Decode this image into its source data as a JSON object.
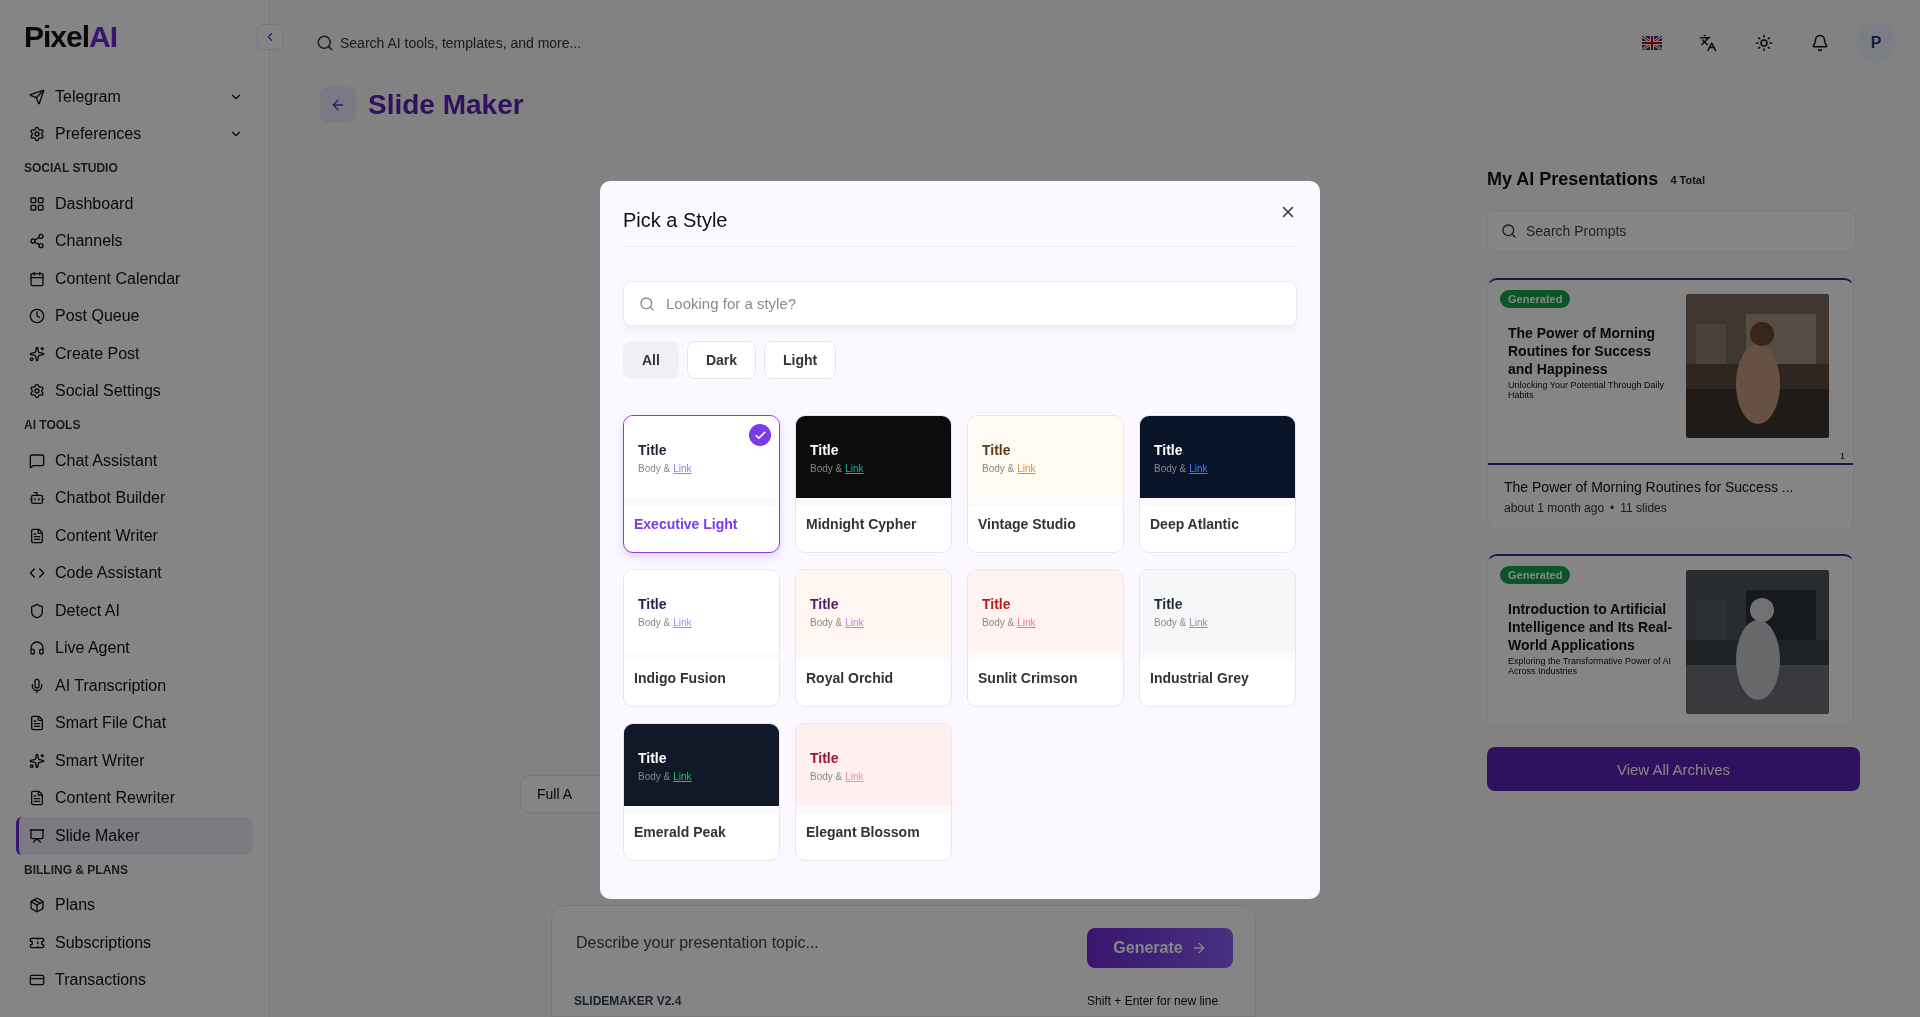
{
  "sidebar": {
    "logo": {
      "text": "Pixel",
      "accent": "AI"
    },
    "top_items": [
      {
        "label": "Telegram",
        "expanded": false
      },
      {
        "label": "Preferences",
        "expanded": false
      }
    ],
    "sections": [
      {
        "heading": "SOCIAL STUDIO",
        "items": [
          {
            "label": "Dashboard",
            "selected": false
          },
          {
            "label": "Channels",
            "selected": false
          },
          {
            "label": "Content Calendar",
            "selected": false
          },
          {
            "label": "Post Queue",
            "selected": false
          },
          {
            "label": "Create Post",
            "selected": false
          },
          {
            "label": "Social Settings",
            "selected": false
          }
        ]
      },
      {
        "heading": "AI TOOLS",
        "items": [
          {
            "label": "Chat Assistant",
            "selected": false
          },
          {
            "label": "Chatbot Builder",
            "selected": false
          },
          {
            "label": "Content Writer",
            "selected": false
          },
          {
            "label": "Code Assistant",
            "selected": false
          },
          {
            "label": "Detect AI",
            "selected": false
          },
          {
            "label": "Live Agent",
            "selected": false
          },
          {
            "label": "AI Transcription",
            "selected": false
          },
          {
            "label": "Smart File Chat",
            "selected": false
          },
          {
            "label": "Smart Writer",
            "selected": false
          },
          {
            "label": "Content Rewriter",
            "selected": false
          },
          {
            "label": "Slide Maker",
            "selected": true
          }
        ]
      },
      {
        "heading": "BILLING & PLANS",
        "items": [
          {
            "label": "Plans",
            "selected": false
          },
          {
            "label": "Subscriptions",
            "selected": false
          },
          {
            "label": "Transactions",
            "selected": false
          }
        ]
      }
    ]
  },
  "header": {
    "search": {
      "placeholder": "Search AI tools, templates, and more..."
    },
    "avatar": "P"
  },
  "page": {
    "title": "Slide Maker",
    "chip": "Full A",
    "prompt": {
      "placeholder": "Describe your presentation topic...",
      "button": "Generate",
      "version": "SLIDEMAKER V2.4",
      "hint": "Shift + Enter for new line"
    }
  },
  "presentations": {
    "title": "My AI Presentations",
    "count": "4 Total",
    "search": {
      "placeholder": "Search Prompts"
    },
    "cards": [
      {
        "badge": "Generated",
        "slide_title": "The Power of Morning Routines for Success and Happiness",
        "slide_subtitle": "Unlocking Your Potential Through Daily Habits",
        "slide_number": "1",
        "title": "The Power of Morning Routines for Success ...",
        "age": "about 1 month ago",
        "separator": "•",
        "slides": "11 slides"
      },
      {
        "badge": "Generated",
        "slide_title": "Introduction to Artificial Intelligence and Its Real-World Applications",
        "slide_subtitle": "Exploring the Transformative Power of AI Across Industries"
      }
    ],
    "button": "View All Archives"
  },
  "modal": {
    "title": "Pick a Style",
    "search": {
      "placeholder": "Looking for a style?"
    },
    "filters": [
      {
        "label": "All",
        "selected": true
      },
      {
        "label": "Dark",
        "selected": false
      },
      {
        "label": "Light",
        "selected": false
      }
    ],
    "styles": [
      {
        "name": "Executive Light",
        "selected": true,
        "color": "#ffffff",
        "title": "Title",
        "body": "Body &",
        "link": "Link"
      },
      {
        "name": "Midnight Cypher",
        "selected": false,
        "color": "#0c0c0c",
        "title": "Title",
        "body": "Body &",
        "link": "Link"
      },
      {
        "name": "Vintage Studio",
        "selected": false,
        "color": "#fffaf2",
        "title": "Title",
        "body": "Body &",
        "link": "Link"
      },
      {
        "name": "Deep Atlantic",
        "selected": false,
        "color": "#0a1429",
        "title": "Title",
        "body": "Body &",
        "link": "Link"
      },
      {
        "name": "Indigo Fusion",
        "selected": false,
        "color": "#ffffff",
        "title": "Title",
        "body": "Body &",
        "link": "Link"
      },
      {
        "name": "Royal Orchid",
        "selected": false,
        "color": "#fff7f2",
        "title": "Title",
        "body": "Body &",
        "link": "Link"
      },
      {
        "name": "Sunlit Crimson",
        "selected": false,
        "color": "#fff3f2",
        "title": "Title",
        "body": "Body &",
        "link": "Link"
      },
      {
        "name": "Industrial Grey",
        "selected": false,
        "color": "#f6f7f8",
        "title": "Title",
        "body": "Body &",
        "link": "Link"
      },
      {
        "name": "Emerald Peak",
        "selected": false,
        "color": "#111827",
        "title": "Title",
        "body": "Body &",
        "link": "Link"
      },
      {
        "name": "Elegant Blossom",
        "selected": false,
        "color": "#fff0f0",
        "title": "Title",
        "body": "Body &",
        "link": "Link"
      }
    ]
  }
}
